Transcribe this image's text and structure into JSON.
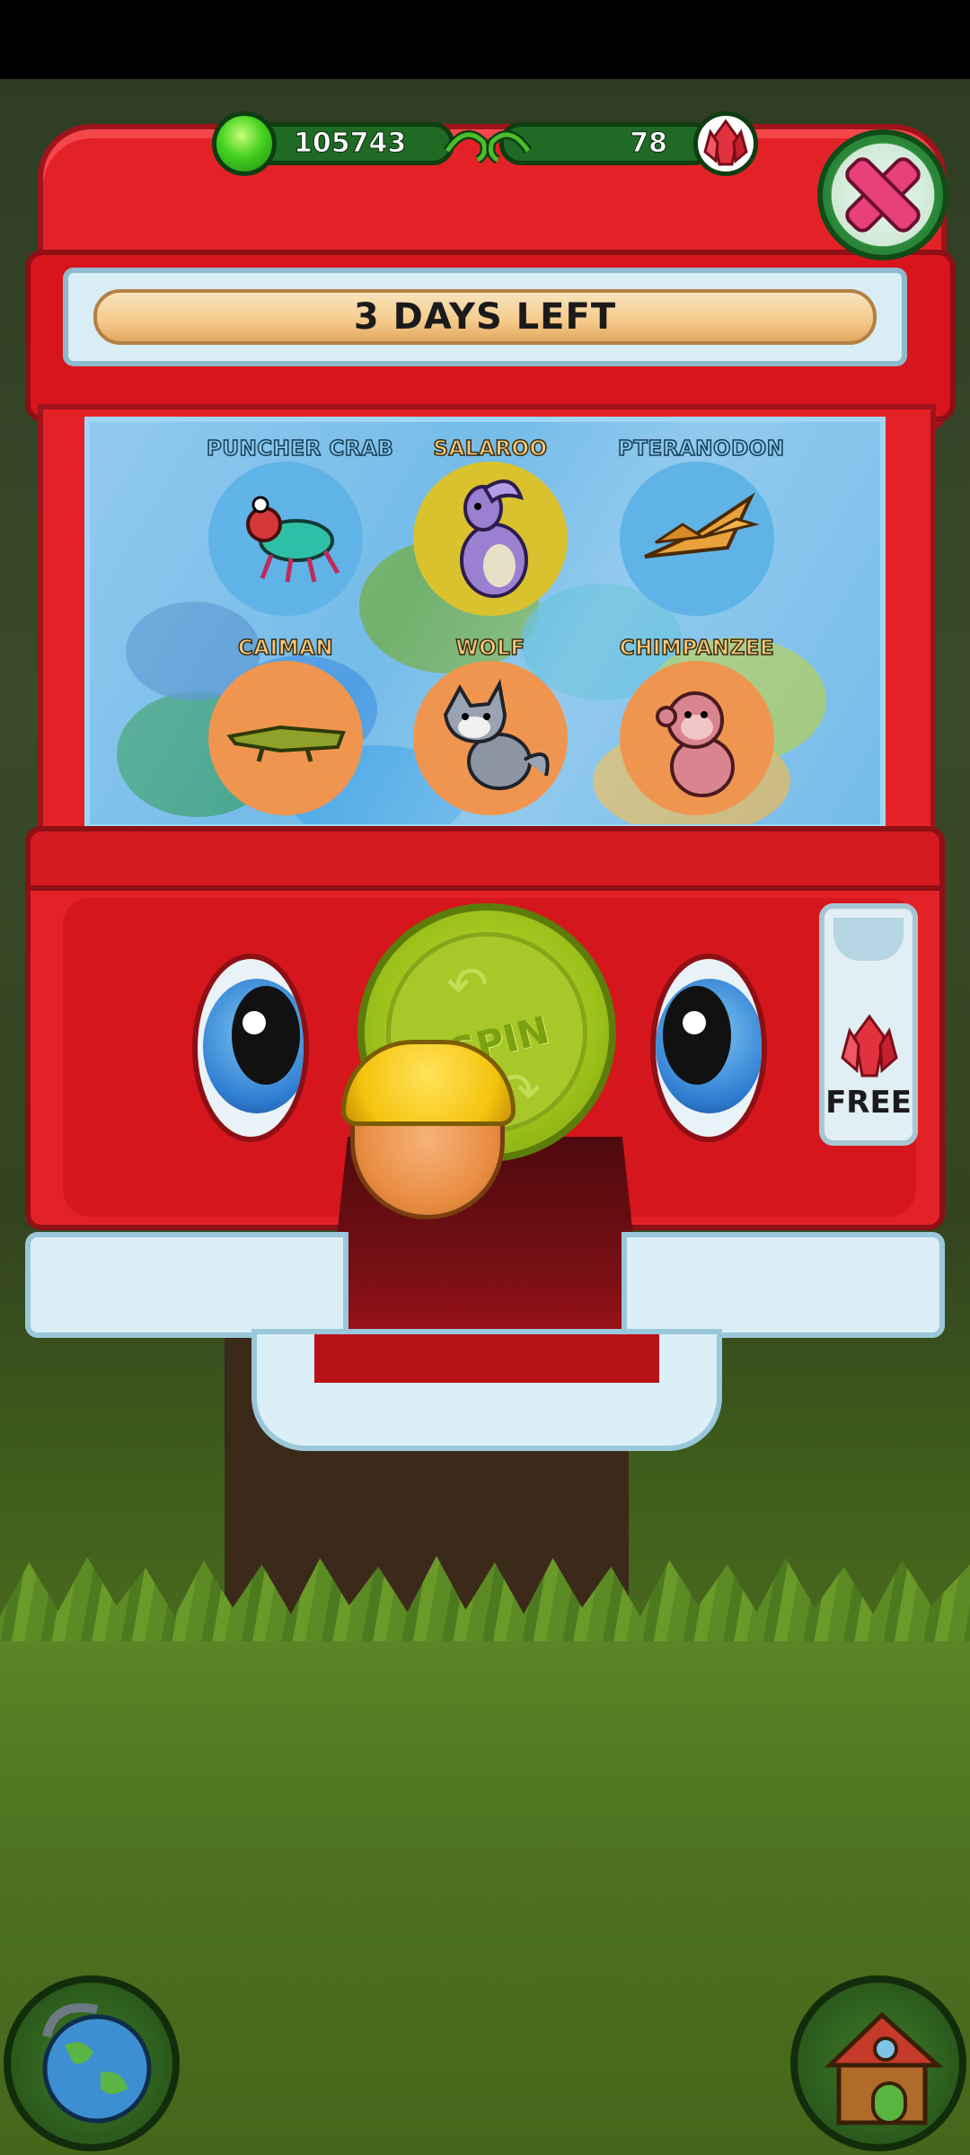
{
  "currency": {
    "green_gems": "105743",
    "red_gems": "78"
  },
  "banner": {
    "text": "3 DAYS LEFT"
  },
  "animals": [
    {
      "name": "PUNCHER CRAB",
      "circle_color": "#5fb3e6"
    },
    {
      "name": "SALAROO",
      "circle_color": "#d9c22e"
    },
    {
      "name": "PTERANODON",
      "circle_color": "#5fb3e6"
    },
    {
      "name": "CAIMAN",
      "circle_color": "#f0954f"
    },
    {
      "name": "WOLF",
      "circle_color": "#f0954f"
    },
    {
      "name": "CHIMPANZEE",
      "circle_color": "#f0954f"
    }
  ],
  "machine": {
    "spin_label": "SPIN",
    "free_label": "FREE"
  },
  "icons": {
    "close": "close-x-icon",
    "globe": "globe-icon",
    "house": "house-icon"
  },
  "colors": {
    "machine_red": "#e32228",
    "spin_green": "#9cc11a",
    "glass_blue": "#6db8e8"
  }
}
